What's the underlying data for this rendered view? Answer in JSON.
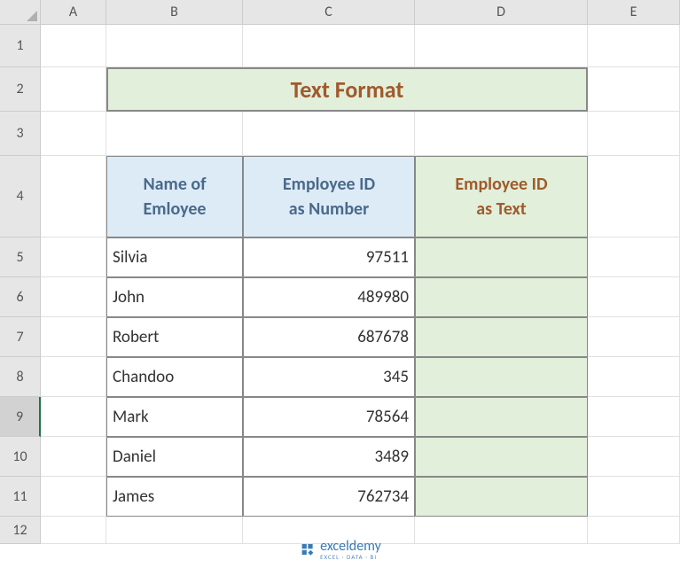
{
  "columns": {
    "a": "A",
    "b": "B",
    "c": "C",
    "d": "D",
    "e": "E"
  },
  "rows": {
    "r1": "1",
    "r2": "2",
    "r3": "3",
    "r4": "4",
    "r5": "5",
    "r6": "6",
    "r7": "7",
    "r8": "8",
    "r9": "9",
    "r10": "10",
    "r11": "11",
    "r12": "12"
  },
  "title": "Text Format",
  "headers": {
    "name_l1": "Name of",
    "name_l2": "Emloyee",
    "idnum_l1": "Employee ID",
    "idnum_l2": "as Number",
    "idtxt_l1": "Employee ID",
    "idtxt_l2": "as Text"
  },
  "data": [
    {
      "name": "Silvia",
      "idnum": "97511",
      "idtxt": ""
    },
    {
      "name": "John",
      "idnum": "489980",
      "idtxt": ""
    },
    {
      "name": "Robert",
      "idnum": "687678",
      "idtxt": ""
    },
    {
      "name": "Chandoo",
      "idnum": "345",
      "idtxt": ""
    },
    {
      "name": "Mark",
      "idnum": "78564",
      "idtxt": ""
    },
    {
      "name": "Daniel",
      "idnum": "3489",
      "idtxt": ""
    },
    {
      "name": "James",
      "idnum": "762734",
      "idtxt": ""
    }
  ],
  "watermark": {
    "name": "exceldemy",
    "sub": "EXCEL · DATA · BI"
  },
  "chart_data": {
    "type": "table",
    "title": "Text Format",
    "columns": [
      "Name of Emloyee",
      "Employee ID as Number",
      "Employee ID as Text"
    ],
    "rows": [
      [
        "Silvia",
        97511,
        ""
      ],
      [
        "John",
        489980,
        ""
      ],
      [
        "Robert",
        687678,
        ""
      ],
      [
        "Chandoo",
        345,
        ""
      ],
      [
        "Mark",
        78564,
        ""
      ],
      [
        "Daniel",
        3489,
        ""
      ],
      [
        "James",
        762734,
        ""
      ]
    ]
  }
}
